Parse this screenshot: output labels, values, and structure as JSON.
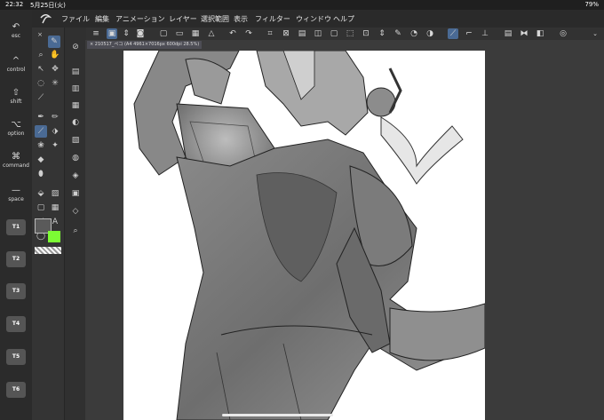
{
  "status": {
    "time": "22:32",
    "date": "5月25日(火)",
    "right": "79%"
  },
  "menu": [
    "ファイル",
    "編集",
    "アニメーション",
    "レイヤー",
    "選択範囲",
    "表示",
    "フィルター",
    "ウィンドウ",
    "ヘルプ"
  ],
  "keys": [
    {
      "glyph": "↶",
      "label": "esc"
    },
    {
      "glyph": "^",
      "label": "control"
    },
    {
      "glyph": "⇧",
      "label": "shift"
    },
    {
      "glyph": "⌥",
      "label": "option"
    },
    {
      "glyph": "⌘",
      "label": "command"
    },
    {
      "glyph": "—",
      "label": "space"
    }
  ],
  "tkeys": [
    "T1",
    "T2",
    "T3",
    "T4",
    "T5",
    "T6"
  ],
  "document": {
    "tab": "× 210517_ペコ (A4 4961×7016px 600dpi 28.5%)"
  },
  "colors": {
    "main": "#5a5a5a",
    "sub": "#7cfc34"
  }
}
